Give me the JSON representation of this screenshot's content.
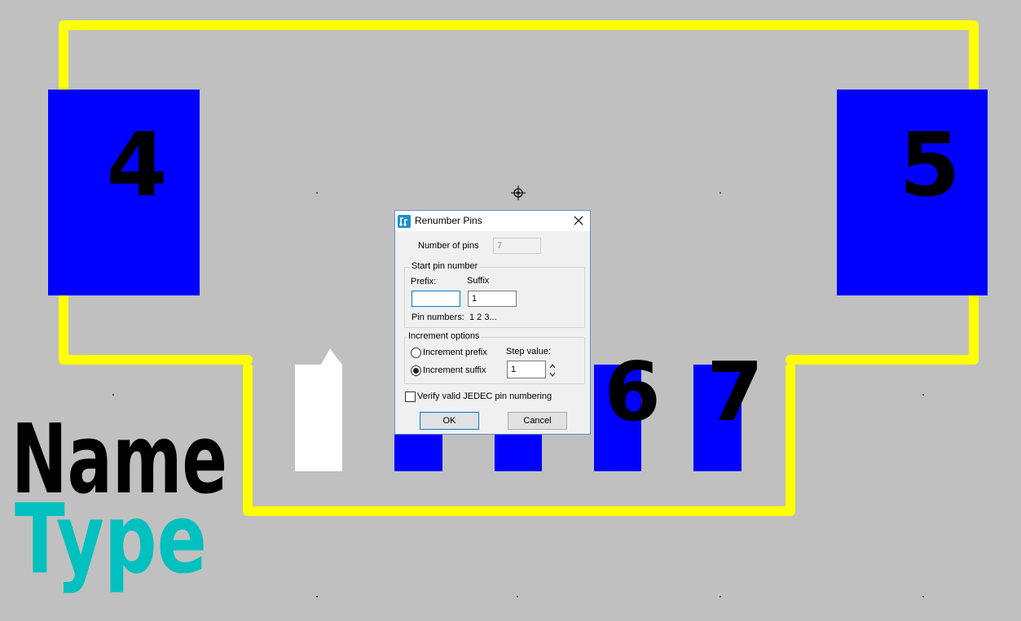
{
  "canvas": {
    "pad_labels": {
      "pad4": "4",
      "pad5": "5",
      "pin6": "6",
      "pin7": "7"
    },
    "name_text": "Name",
    "type_text": "Type",
    "colors": {
      "background": "#c0c0c0",
      "outline": "#ffff00",
      "pad": "#0000ff",
      "selected_pin": "#ffffff",
      "name": "#000000",
      "type": "#00c0c0"
    }
  },
  "dialog": {
    "title": "Renumber Pins",
    "number_of_pins_label": "Number of pins",
    "number_of_pins_value": "7",
    "start_group_title": "Start pin number",
    "prefix_label": "Prefix:",
    "prefix_value": "",
    "suffix_label": "Suffix",
    "suffix_value": "1",
    "pin_numbers_label": "Pin numbers:",
    "pin_numbers_value": "1 2 3...",
    "increment_group_title": "Increment options",
    "increment_prefix_label": "Increment prefix",
    "increment_suffix_label": "Increment suffix",
    "increment_selected": "suffix",
    "step_value_label": "Step value:",
    "step_value": "1",
    "verify_label": "Verify valid JEDEC pin numbering",
    "verify_checked": false,
    "ok_label": "OK",
    "cancel_label": "Cancel"
  }
}
